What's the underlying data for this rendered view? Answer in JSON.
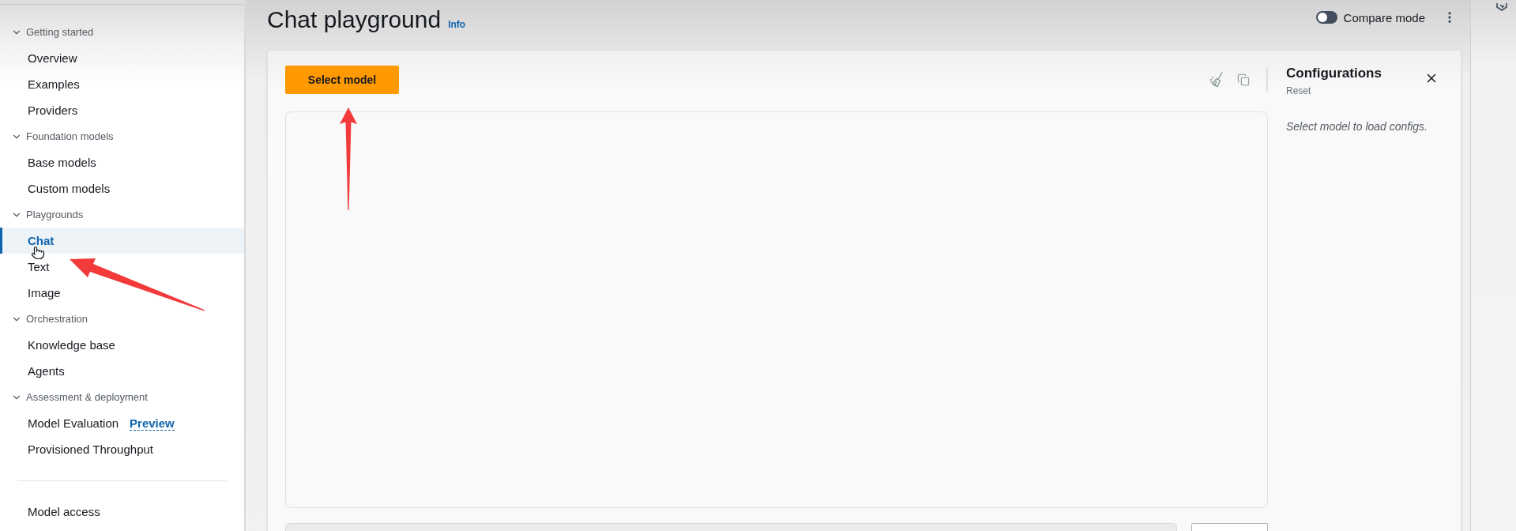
{
  "sidebar": {
    "sections": [
      {
        "label": "Getting started",
        "expanded": true,
        "items": [
          {
            "label": "Overview",
            "selected": false
          },
          {
            "label": "Examples",
            "selected": false
          },
          {
            "label": "Providers",
            "selected": false
          }
        ]
      },
      {
        "label": "Foundation models",
        "expanded": true,
        "items": [
          {
            "label": "Base models",
            "selected": false
          },
          {
            "label": "Custom models",
            "selected": false
          }
        ]
      },
      {
        "label": "Playgrounds",
        "expanded": true,
        "items": [
          {
            "label": "Chat",
            "selected": true
          },
          {
            "label": "Text",
            "selected": false
          },
          {
            "label": "Image",
            "selected": false
          }
        ]
      },
      {
        "label": "Orchestration",
        "expanded": true,
        "items": [
          {
            "label": "Knowledge base",
            "selected": false
          },
          {
            "label": "Agents",
            "selected": false
          }
        ]
      },
      {
        "label": "Assessment & deployment",
        "expanded": true,
        "items": [
          {
            "label": "Model Evaluation",
            "badge": "Preview",
            "selected": false
          },
          {
            "label": "Provisioned Throughput",
            "selected": false
          }
        ]
      }
    ],
    "footer_items": [
      {
        "label": "Model access",
        "selected": false
      }
    ]
  },
  "header": {
    "title": "Chat playground",
    "info_link": "Info",
    "compare_mode": {
      "label": "Compare mode",
      "on": false
    }
  },
  "playground": {
    "select_model_button": "Select model"
  },
  "configurations": {
    "title": "Configurations",
    "reset_link": "Reset",
    "empty_message": "Select model to load configs."
  }
}
